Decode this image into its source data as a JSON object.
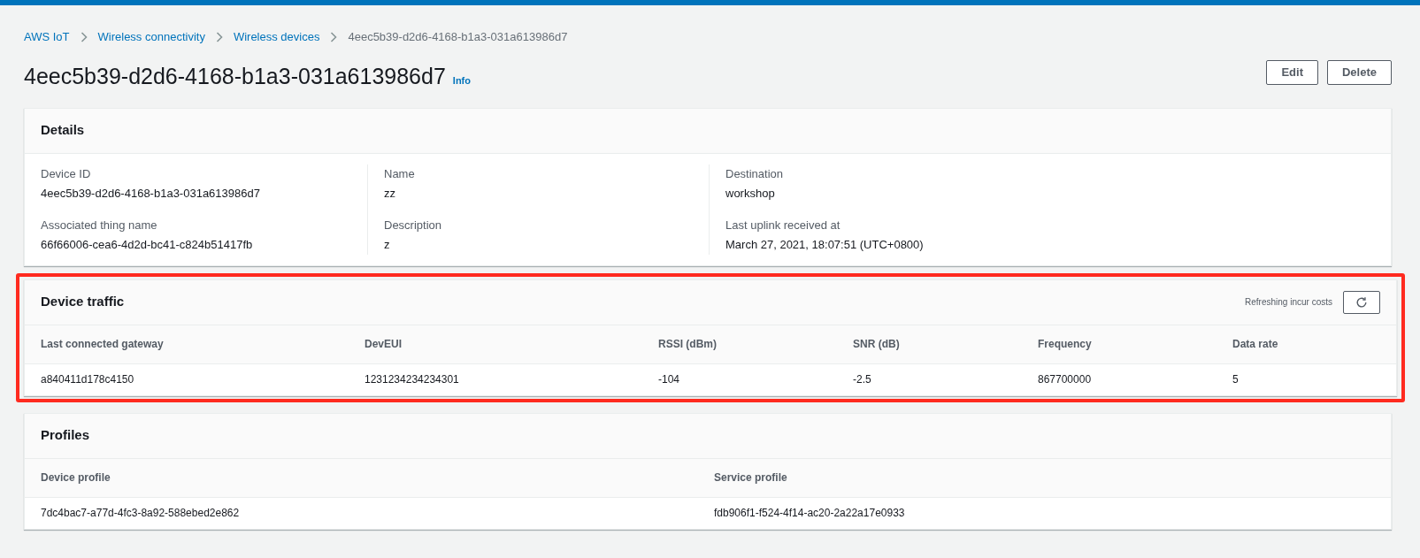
{
  "breadcrumbs": [
    {
      "label": "AWS IoT",
      "link": true
    },
    {
      "label": "Wireless connectivity",
      "link": true
    },
    {
      "label": "Wireless devices",
      "link": true
    },
    {
      "label": "4eec5b39-d2d6-4168-b1a3-031a613986d7",
      "link": false
    }
  ],
  "page_title": "4eec5b39-d2d6-4168-b1a3-031a613986d7",
  "info_link": "Info",
  "header_buttons": [
    "Edit",
    "Delete"
  ],
  "details": {
    "title": "Details",
    "columns": [
      [
        {
          "label": "Device ID",
          "value": "4eec5b39-d2d6-4168-b1a3-031a613986d7"
        },
        {
          "label": "Associated thing name",
          "value": "66f66006-cea6-4d2d-bc41-c824b51417fb"
        }
      ],
      [
        {
          "label": "Name",
          "value": "zz"
        },
        {
          "label": "Description",
          "value": "z"
        }
      ],
      [
        {
          "label": "Destination",
          "value": "workshop"
        },
        {
          "label": "Last uplink received at",
          "value": "March 27, 2021, 18:07:51 (UTC+0800)"
        }
      ]
    ]
  },
  "device_traffic": {
    "title": "Device traffic",
    "highlighted": true,
    "refresh_note": "Refreshing incur costs",
    "columns": [
      "Last connected gateway",
      "DevEUI",
      "RSSI (dBm)",
      "SNR (dB)",
      "Frequency",
      "Data rate"
    ],
    "rows": [
      [
        "a840411d178c4150",
        "1231234234234301",
        "-104",
        "-2.5",
        "867700000",
        "5"
      ]
    ]
  },
  "profiles": {
    "title": "Profiles",
    "columns": [
      "Device profile",
      "Service profile"
    ],
    "rows": [
      [
        "7dc4bac7-a77d-4fc3-8a92-588ebed2e862",
        "fdb906f1-f524-4f14-ac20-2a22a17e0933"
      ]
    ]
  }
}
